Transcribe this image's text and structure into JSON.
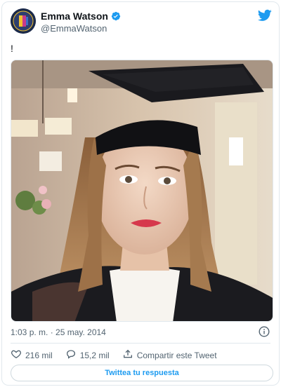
{
  "author": {
    "name": "Emma Watson",
    "handle": "@EmmaWatson",
    "verified_icon": "verified-badge-icon",
    "avatar_icon": "avatar"
  },
  "platform_icon": "twitter-bird-icon",
  "tweet": {
    "text": "!",
    "image_alt": "graduation-selfie-photo"
  },
  "timestamp": "1:03 p. m. · 25 may. 2014",
  "actions": {
    "likes": "216 mil",
    "replies": "15,2 mil",
    "share_label": "Compartir este Tweet"
  },
  "reply_button_label": "Twittea tu respuesta",
  "colors": {
    "brand_blue": "#1d9bf0",
    "text_secondary": "#536471",
    "border": "#e1e8ed"
  }
}
